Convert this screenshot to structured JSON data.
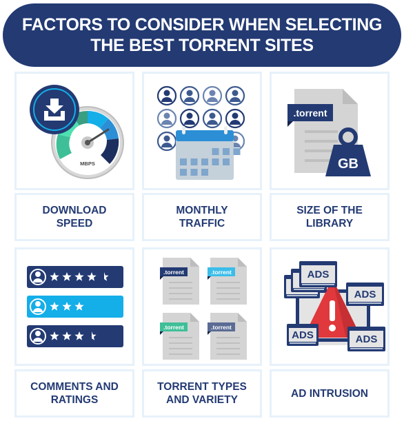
{
  "title": {
    "line1": "FACTORS TO CONSIDER WHEN SELECTING",
    "line2": "THE BEST TORRENT SITES"
  },
  "colors": {
    "navy": "#233a73",
    "sky": "#14aee8",
    "green": "#3fbf98",
    "gray": "#d4d4d4",
    "red": "#e0383c",
    "card_border": "#e6f1fa"
  },
  "factors": [
    {
      "icon": "speedometer-download-icon",
      "label1": "DOWNLOAD",
      "label2": "SPEED",
      "gauge_text": "MBPS"
    },
    {
      "icon": "users-calendar-icon",
      "label1": "MONTHLY",
      "label2": "TRAFFIC"
    },
    {
      "icon": "torrent-file-weight-icon",
      "label1": "SIZE OF THE",
      "label2": "LIBRARY",
      "file_tag": ".torrent",
      "weight_text": "GB"
    },
    {
      "icon": "rating-bars-icon",
      "label1": "COMMENTS AND",
      "label2": "RATINGS",
      "ratings": [
        4.5,
        3,
        3.5
      ]
    },
    {
      "icon": "torrent-files-icon",
      "label1": "TORRENT TYPES",
      "label2": "AND VARIETY",
      "file_tags": [
        ".torrent",
        ".torrent",
        ".torrent",
        ".torrent"
      ]
    },
    {
      "icon": "ads-warning-icon",
      "label1": "AD INTRUSION",
      "label2": "",
      "ad_text": "ADS"
    }
  ]
}
